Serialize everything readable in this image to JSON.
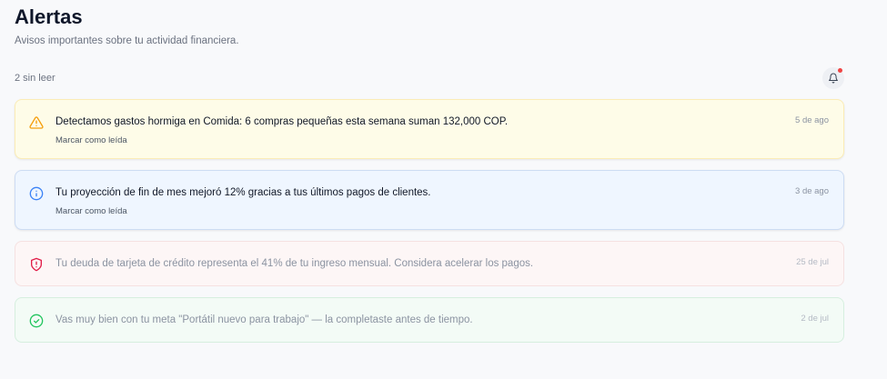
{
  "header": {
    "title": "Alertas",
    "subtitle": "Avisos importantes sobre tu actividad financiera."
  },
  "toolbar": {
    "unread_count_text": "2 sin leer",
    "bell_icon": "bell-icon"
  },
  "colors": {
    "warning": "#f59e0b",
    "info": "#3b82f6",
    "danger": "#e11d48",
    "success": "#22c55e",
    "unread_dot": "#ef4444"
  },
  "alerts": [
    {
      "type": "warning",
      "icon": "warning-triangle-icon",
      "message": "Detectamos gastos hormiga en Comida: 6 compras pequeñas esta semana suman 132,000 COP.",
      "date": "5 de ago",
      "action": "Marcar como leída",
      "read": false
    },
    {
      "type": "info",
      "icon": "info-circle-icon",
      "message": "Tu proyección de fin de mes mejoró 12% gracias a tus últimos pagos de clientes.",
      "date": "3 de ago",
      "action": "Marcar como leída",
      "read": false
    },
    {
      "type": "danger",
      "icon": "shield-alert-icon",
      "message": "Tu deuda de tarjeta de crédito representa el 41% de tu ingreso mensual. Considera acelerar los pagos.",
      "date": "25 de jul",
      "read": true
    },
    {
      "type": "success",
      "icon": "check-circle-icon",
      "message": "Vas muy bien con tu meta \"Portátil nuevo para trabajo\" — la completaste antes de tiempo.",
      "date": "2 de jul",
      "read": true
    }
  ]
}
